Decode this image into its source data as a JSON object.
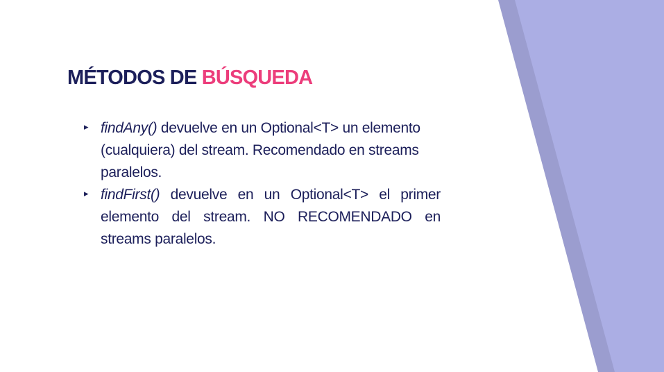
{
  "slide": {
    "title_main": "MÉTODOS DE",
    "title_accent": "BÚSQUEDA",
    "bullets": [
      {
        "method": "findAny()",
        "text": " devuelve en un Optional<T> un elemento (cualquiera) del stream. Recomendado en streams paralelos."
      },
      {
        "method": "findFirst()",
        "text": " devuelve en un Optional<T> el primer elemento del stream. NO RECOMENDADO en streams paralelos."
      }
    ],
    "bullet_marker": "▸"
  },
  "colors": {
    "title": "#1c1f5a",
    "accent": "#ec3d7b",
    "text": "#1c1f5a",
    "band_light": "#abaee4",
    "band_dark": "#9b9dcf"
  }
}
